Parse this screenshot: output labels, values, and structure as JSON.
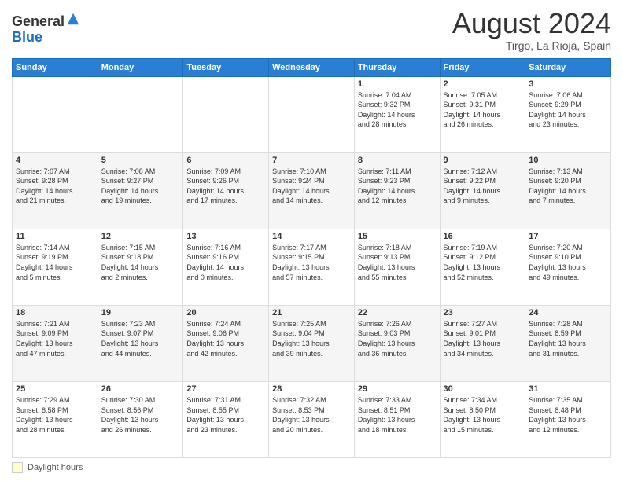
{
  "header": {
    "logo_general": "General",
    "logo_blue": "Blue",
    "month_year": "August 2024",
    "location": "Tirgo, La Rioja, Spain"
  },
  "days_of_week": [
    "Sunday",
    "Monday",
    "Tuesday",
    "Wednesday",
    "Thursday",
    "Friday",
    "Saturday"
  ],
  "footer": {
    "daylight_label": "Daylight hours"
  },
  "weeks": [
    {
      "days": [
        {
          "num": "",
          "info": ""
        },
        {
          "num": "",
          "info": ""
        },
        {
          "num": "",
          "info": ""
        },
        {
          "num": "",
          "info": ""
        },
        {
          "num": "1",
          "info": "Sunrise: 7:04 AM\nSunset: 9:32 PM\nDaylight: 14 hours\nand 28 minutes."
        },
        {
          "num": "2",
          "info": "Sunrise: 7:05 AM\nSunset: 9:31 PM\nDaylight: 14 hours\nand 26 minutes."
        },
        {
          "num": "3",
          "info": "Sunrise: 7:06 AM\nSunset: 9:29 PM\nDaylight: 14 hours\nand 23 minutes."
        }
      ]
    },
    {
      "days": [
        {
          "num": "4",
          "info": "Sunrise: 7:07 AM\nSunset: 9:28 PM\nDaylight: 14 hours\nand 21 minutes."
        },
        {
          "num": "5",
          "info": "Sunrise: 7:08 AM\nSunset: 9:27 PM\nDaylight: 14 hours\nand 19 minutes."
        },
        {
          "num": "6",
          "info": "Sunrise: 7:09 AM\nSunset: 9:26 PM\nDaylight: 14 hours\nand 17 minutes."
        },
        {
          "num": "7",
          "info": "Sunrise: 7:10 AM\nSunset: 9:24 PM\nDaylight: 14 hours\nand 14 minutes."
        },
        {
          "num": "8",
          "info": "Sunrise: 7:11 AM\nSunset: 9:23 PM\nDaylight: 14 hours\nand 12 minutes."
        },
        {
          "num": "9",
          "info": "Sunrise: 7:12 AM\nSunset: 9:22 PM\nDaylight: 14 hours\nand 9 minutes."
        },
        {
          "num": "10",
          "info": "Sunrise: 7:13 AM\nSunset: 9:20 PM\nDaylight: 14 hours\nand 7 minutes."
        }
      ]
    },
    {
      "days": [
        {
          "num": "11",
          "info": "Sunrise: 7:14 AM\nSunset: 9:19 PM\nDaylight: 14 hours\nand 5 minutes."
        },
        {
          "num": "12",
          "info": "Sunrise: 7:15 AM\nSunset: 9:18 PM\nDaylight: 14 hours\nand 2 minutes."
        },
        {
          "num": "13",
          "info": "Sunrise: 7:16 AM\nSunset: 9:16 PM\nDaylight: 14 hours\nand 0 minutes."
        },
        {
          "num": "14",
          "info": "Sunrise: 7:17 AM\nSunset: 9:15 PM\nDaylight: 13 hours\nand 57 minutes."
        },
        {
          "num": "15",
          "info": "Sunrise: 7:18 AM\nSunset: 9:13 PM\nDaylight: 13 hours\nand 55 minutes."
        },
        {
          "num": "16",
          "info": "Sunrise: 7:19 AM\nSunset: 9:12 PM\nDaylight: 13 hours\nand 52 minutes."
        },
        {
          "num": "17",
          "info": "Sunrise: 7:20 AM\nSunset: 9:10 PM\nDaylight: 13 hours\nand 49 minutes."
        }
      ]
    },
    {
      "days": [
        {
          "num": "18",
          "info": "Sunrise: 7:21 AM\nSunset: 9:09 PM\nDaylight: 13 hours\nand 47 minutes."
        },
        {
          "num": "19",
          "info": "Sunrise: 7:23 AM\nSunset: 9:07 PM\nDaylight: 13 hours\nand 44 minutes."
        },
        {
          "num": "20",
          "info": "Sunrise: 7:24 AM\nSunset: 9:06 PM\nDaylight: 13 hours\nand 42 minutes."
        },
        {
          "num": "21",
          "info": "Sunrise: 7:25 AM\nSunset: 9:04 PM\nDaylight: 13 hours\nand 39 minutes."
        },
        {
          "num": "22",
          "info": "Sunrise: 7:26 AM\nSunset: 9:03 PM\nDaylight: 13 hours\nand 36 minutes."
        },
        {
          "num": "23",
          "info": "Sunrise: 7:27 AM\nSunset: 9:01 PM\nDaylight: 13 hours\nand 34 minutes."
        },
        {
          "num": "24",
          "info": "Sunrise: 7:28 AM\nSunset: 8:59 PM\nDaylight: 13 hours\nand 31 minutes."
        }
      ]
    },
    {
      "days": [
        {
          "num": "25",
          "info": "Sunrise: 7:29 AM\nSunset: 8:58 PM\nDaylight: 13 hours\nand 28 minutes."
        },
        {
          "num": "26",
          "info": "Sunrise: 7:30 AM\nSunset: 8:56 PM\nDaylight: 13 hours\nand 26 minutes."
        },
        {
          "num": "27",
          "info": "Sunrise: 7:31 AM\nSunset: 8:55 PM\nDaylight: 13 hours\nand 23 minutes."
        },
        {
          "num": "28",
          "info": "Sunrise: 7:32 AM\nSunset: 8:53 PM\nDaylight: 13 hours\nand 20 minutes."
        },
        {
          "num": "29",
          "info": "Sunrise: 7:33 AM\nSunset: 8:51 PM\nDaylight: 13 hours\nand 18 minutes."
        },
        {
          "num": "30",
          "info": "Sunrise: 7:34 AM\nSunset: 8:50 PM\nDaylight: 13 hours\nand 15 minutes."
        },
        {
          "num": "31",
          "info": "Sunrise: 7:35 AM\nSunset: 8:48 PM\nDaylight: 13 hours\nand 12 minutes."
        }
      ]
    }
  ]
}
